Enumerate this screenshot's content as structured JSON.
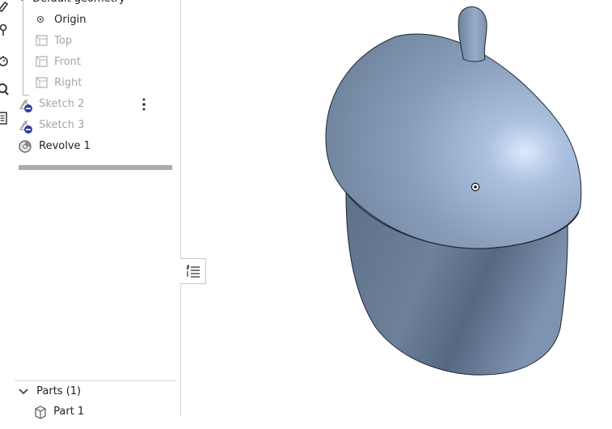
{
  "feature_tree": {
    "default_geometry": {
      "label": "Default geometry"
    },
    "items": [
      {
        "label": "Origin",
        "state": "active"
      },
      {
        "label": "Top",
        "state": "hidden"
      },
      {
        "label": "Front",
        "state": "hidden"
      },
      {
        "label": "Right",
        "state": "hidden"
      },
      {
        "label": "Sketch 2",
        "state": "hidden"
      },
      {
        "label": "Sketch 3",
        "state": "hidden"
      },
      {
        "label": "Revolve 1",
        "state": "active"
      }
    ]
  },
  "parts": {
    "header": "Parts (1)",
    "items": [
      {
        "label": "Part 1"
      }
    ]
  },
  "colors": {
    "part_fill": "#7f95b2",
    "part_highlight": "#b2c7e6",
    "part_shadow": "#566880",
    "hidden_text": "#a5a5a5",
    "sketch_badge": "#2e3da6"
  }
}
